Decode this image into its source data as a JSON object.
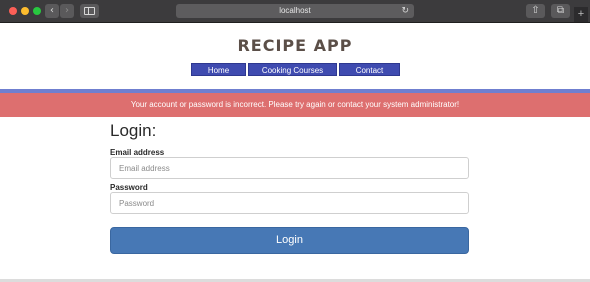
{
  "browser": {
    "url": "localhost",
    "icons": {
      "back": "chevron-left-icon",
      "forward": "chevron-right-icon",
      "sidebar": "sidebar-icon",
      "reload": "reload-icon",
      "share": "share-icon",
      "tabs": "tabs-icon",
      "new_tab": "plus-icon"
    }
  },
  "header": {
    "title": "RECIPE APP",
    "nav": [
      {
        "label": "Home"
      },
      {
        "label": "Cooking Courses"
      },
      {
        "label": "Contact"
      }
    ]
  },
  "alert": {
    "message": "Your account or password is incorrect. Please try again or contact your system administrator!",
    "color": "#dd6f6f"
  },
  "login": {
    "heading": "Login:",
    "email_label": "Email address",
    "email_placeholder": "Email address",
    "email_value": "",
    "password_label": "Password",
    "password_placeholder": "Password",
    "password_value": "",
    "submit_label": "Login",
    "button_color": "#4778b5"
  },
  "colors": {
    "nav": "#3f4bb0",
    "title": "#5b4f48",
    "accent_strip": "#6f7fd0"
  }
}
